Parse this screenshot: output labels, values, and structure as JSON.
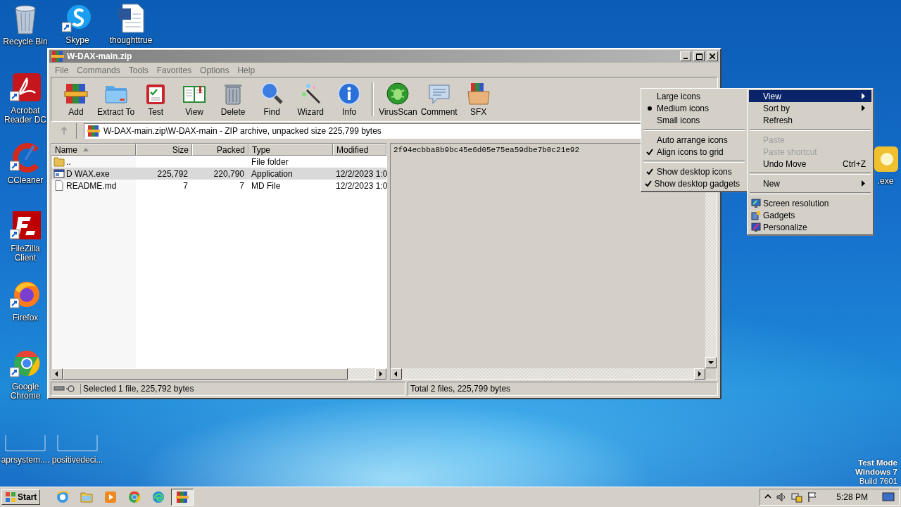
{
  "desktop_icons": [
    {
      "label": "Recycle Bin"
    },
    {
      "label": "Skype"
    },
    {
      "label": "thoughttrue"
    },
    {
      "label": "Acrobat Reader DC"
    },
    {
      "label": "CCleaner"
    },
    {
      "label": "FileZilla Client"
    },
    {
      "label": "Firefox"
    },
    {
      "label": "Google Chrome"
    },
    {
      "label": "aprsystem...."
    },
    {
      "label": "positivedeci..."
    },
    {
      "label": ".exe"
    }
  ],
  "window": {
    "title": "W-DAX-main.zip",
    "menu": [
      "File",
      "Commands",
      "Tools",
      "Favorites",
      "Options",
      "Help"
    ],
    "toolbar": [
      {
        "label": "Add"
      },
      {
        "label": "Extract To"
      },
      {
        "label": "Test"
      },
      {
        "label": "View"
      },
      {
        "label": "Delete"
      },
      {
        "label": "Find"
      },
      {
        "label": "Wizard"
      },
      {
        "label": "Info"
      },
      {
        "label": "VirusScan"
      },
      {
        "label": "Comment"
      },
      {
        "label": "SFX"
      }
    ],
    "address": "W-DAX-main.zip\\W-DAX-main - ZIP archive, unpacked size 225,799 bytes",
    "table": {
      "columns": [
        {
          "label": "Name",
          "sorted": true
        },
        {
          "label": "Size",
          "sorted": false
        },
        {
          "label": "Packed",
          "sorted": false
        },
        {
          "label": "Type",
          "sorted": false
        },
        {
          "label": "Modified",
          "sorted": false
        }
      ],
      "rows": [
        {
          "kind": "folder",
          "name": "..",
          "size": "",
          "packed": "",
          "type": "File folder",
          "modified": "",
          "selected": false
        },
        {
          "kind": "exe",
          "name": "D WAX.exe",
          "size": "225,792",
          "packed": "220,790",
          "type": "Application",
          "modified": "12/2/2023 1:0",
          "selected": true
        },
        {
          "kind": "file",
          "name": "README.md",
          "size": "7",
          "packed": "7",
          "type": "MD File",
          "modified": "12/2/2023 1:0",
          "selected": false
        }
      ]
    },
    "comment": "2f94ecbba8b9bc45e6d05e75ea59dbe7b0c21e92",
    "status_left": "Selected 1 file, 225,792 bytes",
    "status_right": "Total 2 files, 225,799 bytes"
  },
  "view_submenu": {
    "items": [
      {
        "kind": "radio",
        "label": "Large icons",
        "selected": false
      },
      {
        "kind": "radio",
        "label": "Medium icons",
        "selected": true
      },
      {
        "kind": "radio",
        "label": "Small icons",
        "selected": false
      },
      {
        "kind": "separator"
      },
      {
        "kind": "check",
        "label": "Auto arrange icons",
        "checked": false
      },
      {
        "kind": "check",
        "label": "Align icons to grid",
        "checked": true
      },
      {
        "kind": "separator"
      },
      {
        "kind": "check",
        "label": "Show desktop icons",
        "checked": true
      },
      {
        "kind": "check",
        "label": "Show desktop gadgets",
        "checked": true
      }
    ]
  },
  "context_menu": {
    "items": [
      {
        "kind": "item",
        "label": "View",
        "submenu": true,
        "selected": true,
        "disabled": false
      },
      {
        "kind": "item",
        "label": "Sort by",
        "submenu": true,
        "selected": false,
        "disabled": false
      },
      {
        "kind": "item",
        "label": "Refresh",
        "submenu": false,
        "selected": false,
        "disabled": false
      },
      {
        "kind": "separator"
      },
      {
        "kind": "item",
        "label": "Paste",
        "submenu": false,
        "selected": false,
        "disabled": true
      },
      {
        "kind": "item",
        "label": "Paste shortcut",
        "submenu": false,
        "selected": false,
        "disabled": true
      },
      {
        "kind": "item",
        "label": "Undo Move",
        "shortcut": "Ctrl+Z",
        "submenu": false,
        "selected": false,
        "disabled": false
      },
      {
        "kind": "separator"
      },
      {
        "kind": "item",
        "label": "New",
        "submenu": true,
        "selected": false,
        "disabled": false
      },
      {
        "kind": "separator"
      },
      {
        "kind": "setting",
        "label": "Screen resolution",
        "submenu": false,
        "selected": false,
        "disabled": false
      },
      {
        "kind": "setting",
        "label": "Gadgets",
        "submenu": false,
        "selected": false,
        "disabled": false
      },
      {
        "kind": "setting",
        "label": "Personalize",
        "submenu": false,
        "selected": false,
        "disabled": false
      }
    ]
  },
  "os_info": [
    "Test Mode",
    "Windows 7",
    "Build 7601"
  ],
  "taskbar": {
    "start": "Start",
    "apps": [
      {
        "active": false
      },
      {
        "active": false
      },
      {
        "active": false
      },
      {
        "active": false
      },
      {
        "active": false
      },
      {
        "active": true
      }
    ],
    "clock": "5:28 PM"
  }
}
